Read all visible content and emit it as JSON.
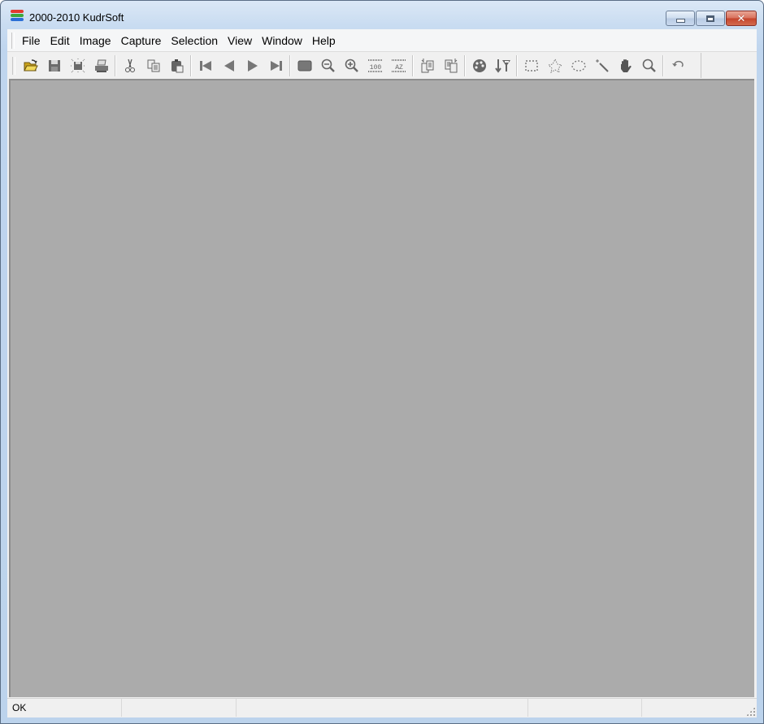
{
  "window": {
    "title": "2000-2010 KudrSoft",
    "app_icon": "stacked-color-bars-icon",
    "app_icon_colors": [
      "#e23a2e",
      "#3ba83b",
      "#2b6fd6"
    ],
    "caption_buttons": [
      "minimize",
      "maximize",
      "close"
    ]
  },
  "menu": {
    "items": [
      "File",
      "Edit",
      "Image",
      "Capture",
      "Selection",
      "View",
      "Window",
      "Help"
    ]
  },
  "toolbar": {
    "groups": [
      [
        "open-folder-icon",
        "save-icon",
        "save-selection-icon",
        "print-icon"
      ],
      [
        "cut-icon",
        "copy-icon",
        "paste-icon"
      ],
      [
        "first-icon",
        "previous-icon",
        "next-icon",
        "last-icon"
      ],
      [
        "fit-window-icon",
        "zoom-out-icon",
        "zoom-in-icon",
        "actual-size-100-icon",
        "auto-zoom-az-icon"
      ],
      [
        "import-pages-icon",
        "export-pages-icon"
      ],
      [
        "palette-icon",
        "sort-filter-icon"
      ],
      [
        "rectangle-select-icon",
        "polygon-select-icon",
        "ellipse-select-icon",
        "magic-wand-icon",
        "hand-pan-icon",
        "magnifier-icon"
      ],
      [
        "undo-icon"
      ]
    ],
    "labels": {
      "actual_size": "100",
      "auto_zoom": "AZ"
    }
  },
  "workspace": {
    "background": "#ababab"
  },
  "statusbar": {
    "panes": [
      "OK",
      "",
      "",
      "",
      "",
      ""
    ]
  }
}
